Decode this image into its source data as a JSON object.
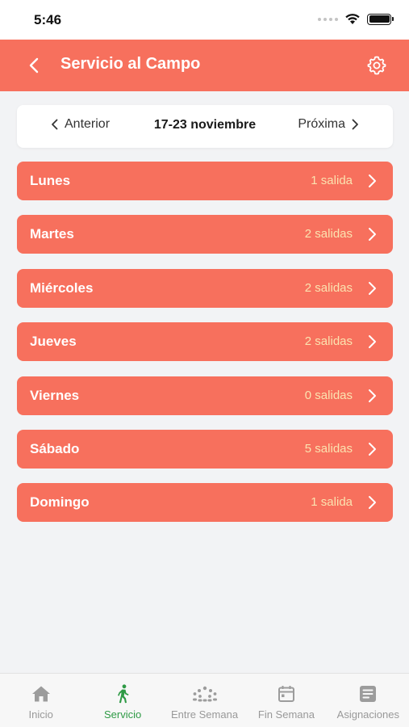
{
  "status_bar": {
    "time": "5:46"
  },
  "header": {
    "title": "Servicio al Campo"
  },
  "week_nav": {
    "prev_label": "Anterior",
    "range": "17-23 noviembre",
    "next_label": "Próxima"
  },
  "days": [
    {
      "name": "Lunes",
      "count": "1 salida"
    },
    {
      "name": "Martes",
      "count": "2 salidas"
    },
    {
      "name": "Miércoles",
      "count": "2 salidas"
    },
    {
      "name": "Jueves",
      "count": "2 salidas"
    },
    {
      "name": "Viernes",
      "count": "0 salidas"
    },
    {
      "name": "Sábado",
      "count": "5 salidas"
    },
    {
      "name": "Domingo",
      "count": "1 salida"
    }
  ],
  "tabs": [
    {
      "label": "Inicio",
      "icon": "home-icon",
      "active": false
    },
    {
      "label": "Servicio",
      "icon": "walking-person-icon",
      "active": true
    },
    {
      "label": "Entre Semana",
      "icon": "group-icon",
      "active": false
    },
    {
      "label": "Fin Semana",
      "icon": "calendar-icon",
      "active": false
    },
    {
      "label": "Asignaciones",
      "icon": "document-icon",
      "active": false
    }
  ],
  "colors": {
    "accent": "#f7705d",
    "count_text": "#fbe3b0",
    "active_tab": "#2e9a45",
    "inactive_tab": "#999999",
    "background": "#f2f3f5"
  }
}
